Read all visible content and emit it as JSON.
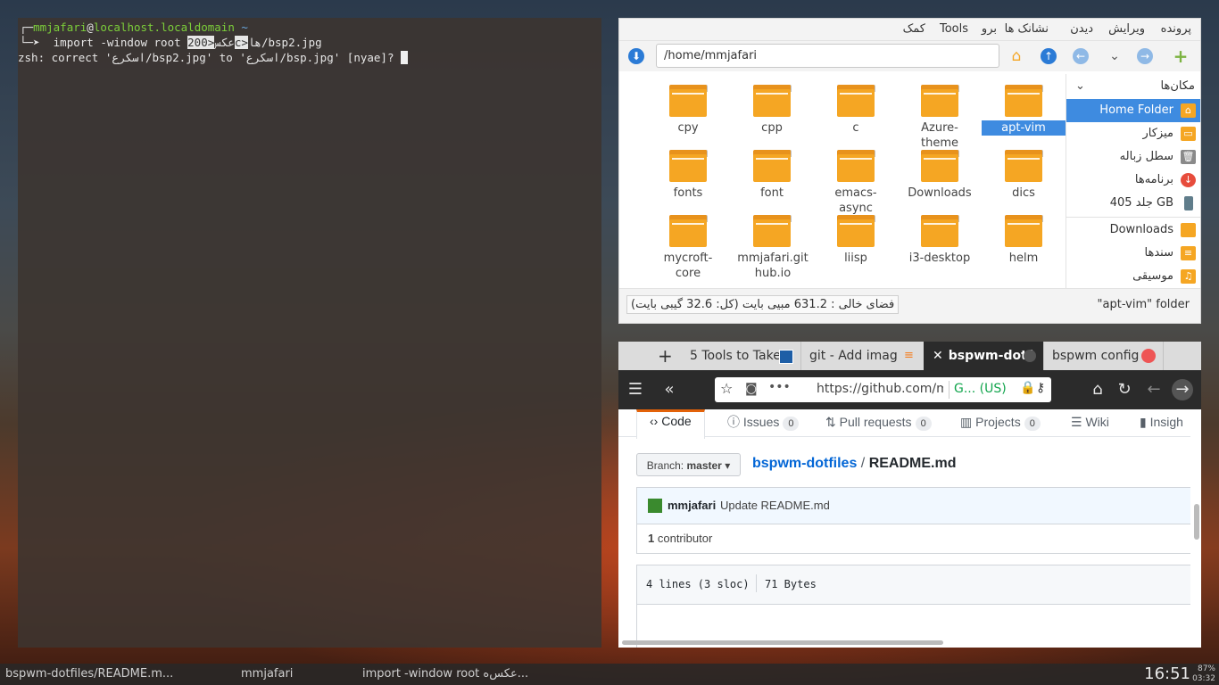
{
  "terminal": {
    "user": "mmjafari",
    "at": "@",
    "host": "localhost.localdomain",
    "tilde": " ~",
    "cmd_pre": "import -window root عکس",
    "cmd_sel": "<200c>",
    "cmd_post": "ها/bsp2.jpg",
    "correct_line": "zsh: correct 'اسکرع/bsp2.jpg' to 'اسکرع/bsp.jpg' [nyae]? "
  },
  "filemanager": {
    "menu": [
      "پرونده",
      "ویرایش",
      "دیدن",
      "نشانک ها",
      "برو",
      "Tools",
      "کمک"
    ],
    "path": "/home/mmjafari",
    "items": [
      {
        "label": "cpy"
      },
      {
        "label": "cpp"
      },
      {
        "label": "c"
      },
      {
        "label": "Azure-theme"
      },
      {
        "label": "apt-vim",
        "selected": true
      },
      {
        "label": "fonts"
      },
      {
        "label": "font"
      },
      {
        "label": "emacs-async"
      },
      {
        "label": "Downloads"
      },
      {
        "label": "dics"
      },
      {
        "label": "mycroft-core"
      },
      {
        "label": "mmjafari.github.io"
      },
      {
        "label": "liisp"
      },
      {
        "label": "i3-desktop"
      },
      {
        "label": "helm"
      }
    ],
    "places_title": "مکان‌ها",
    "places": [
      {
        "label": "Home Folder",
        "icon": "home-icon",
        "color": "#f5a623",
        "active": true
      },
      {
        "label": "میزکار",
        "icon": "desktop-icon",
        "color": "#f5a623"
      },
      {
        "label": "سطل زباله",
        "icon": "trash-icon",
        "color": "#8a8a8a"
      },
      {
        "label": "برنامه‌ها",
        "icon": "apps-icon",
        "color": "#e74c3c"
      },
      {
        "label": "جلد 405 GB",
        "icon": "drive-icon",
        "color": "#607d8b"
      },
      {
        "label": "Downloads",
        "icon": "folder-icon",
        "color": "#f5a623"
      },
      {
        "label": "سندها",
        "icon": "documents-icon",
        "color": "#f5a623"
      },
      {
        "label": "موسیقی",
        "icon": "music-icon",
        "color": "#f5a623"
      }
    ],
    "status_right": "\"apt-vim\" folder",
    "status_left": "فضای خالی : 631.2 مبیی بایت (کل: 32.6 گیبی بایت)"
  },
  "browser": {
    "tabs": [
      "5 Tools to Take",
      "git - Add imag",
      "bspwm-dotf",
      "bspwm config"
    ],
    "url": "https://github.com/mm",
    "cert": "G... (US)",
    "gh_tabs": [
      {
        "label": "Code",
        "count": ""
      },
      {
        "label": "Issues",
        "count": "0"
      },
      {
        "label": "Pull requests",
        "count": "0"
      },
      {
        "label": "Projects",
        "count": "0"
      },
      {
        "label": "Wiki",
        "count": ""
      },
      {
        "label": "Insigh",
        "count": ""
      }
    ],
    "branch_label": "Branch:",
    "branch_name": "master",
    "repo": "bspwm-dotfiles",
    "sep": "/",
    "file": "README.md",
    "commit_author": "mmjafari",
    "commit_msg": "Update README.md",
    "contributors_count": "1",
    "contributors_label": "contributor",
    "lines": "4 lines (3 sloc)",
    "size": "71 Bytes"
  },
  "taskbar": {
    "win1": "bspwm-dotfiles/README.m...",
    "win2": "mmjafari",
    "win3": "import -window root عکس‌ه...",
    "time": "16:51",
    "battery": "87%",
    "battery_time": "03:32"
  }
}
